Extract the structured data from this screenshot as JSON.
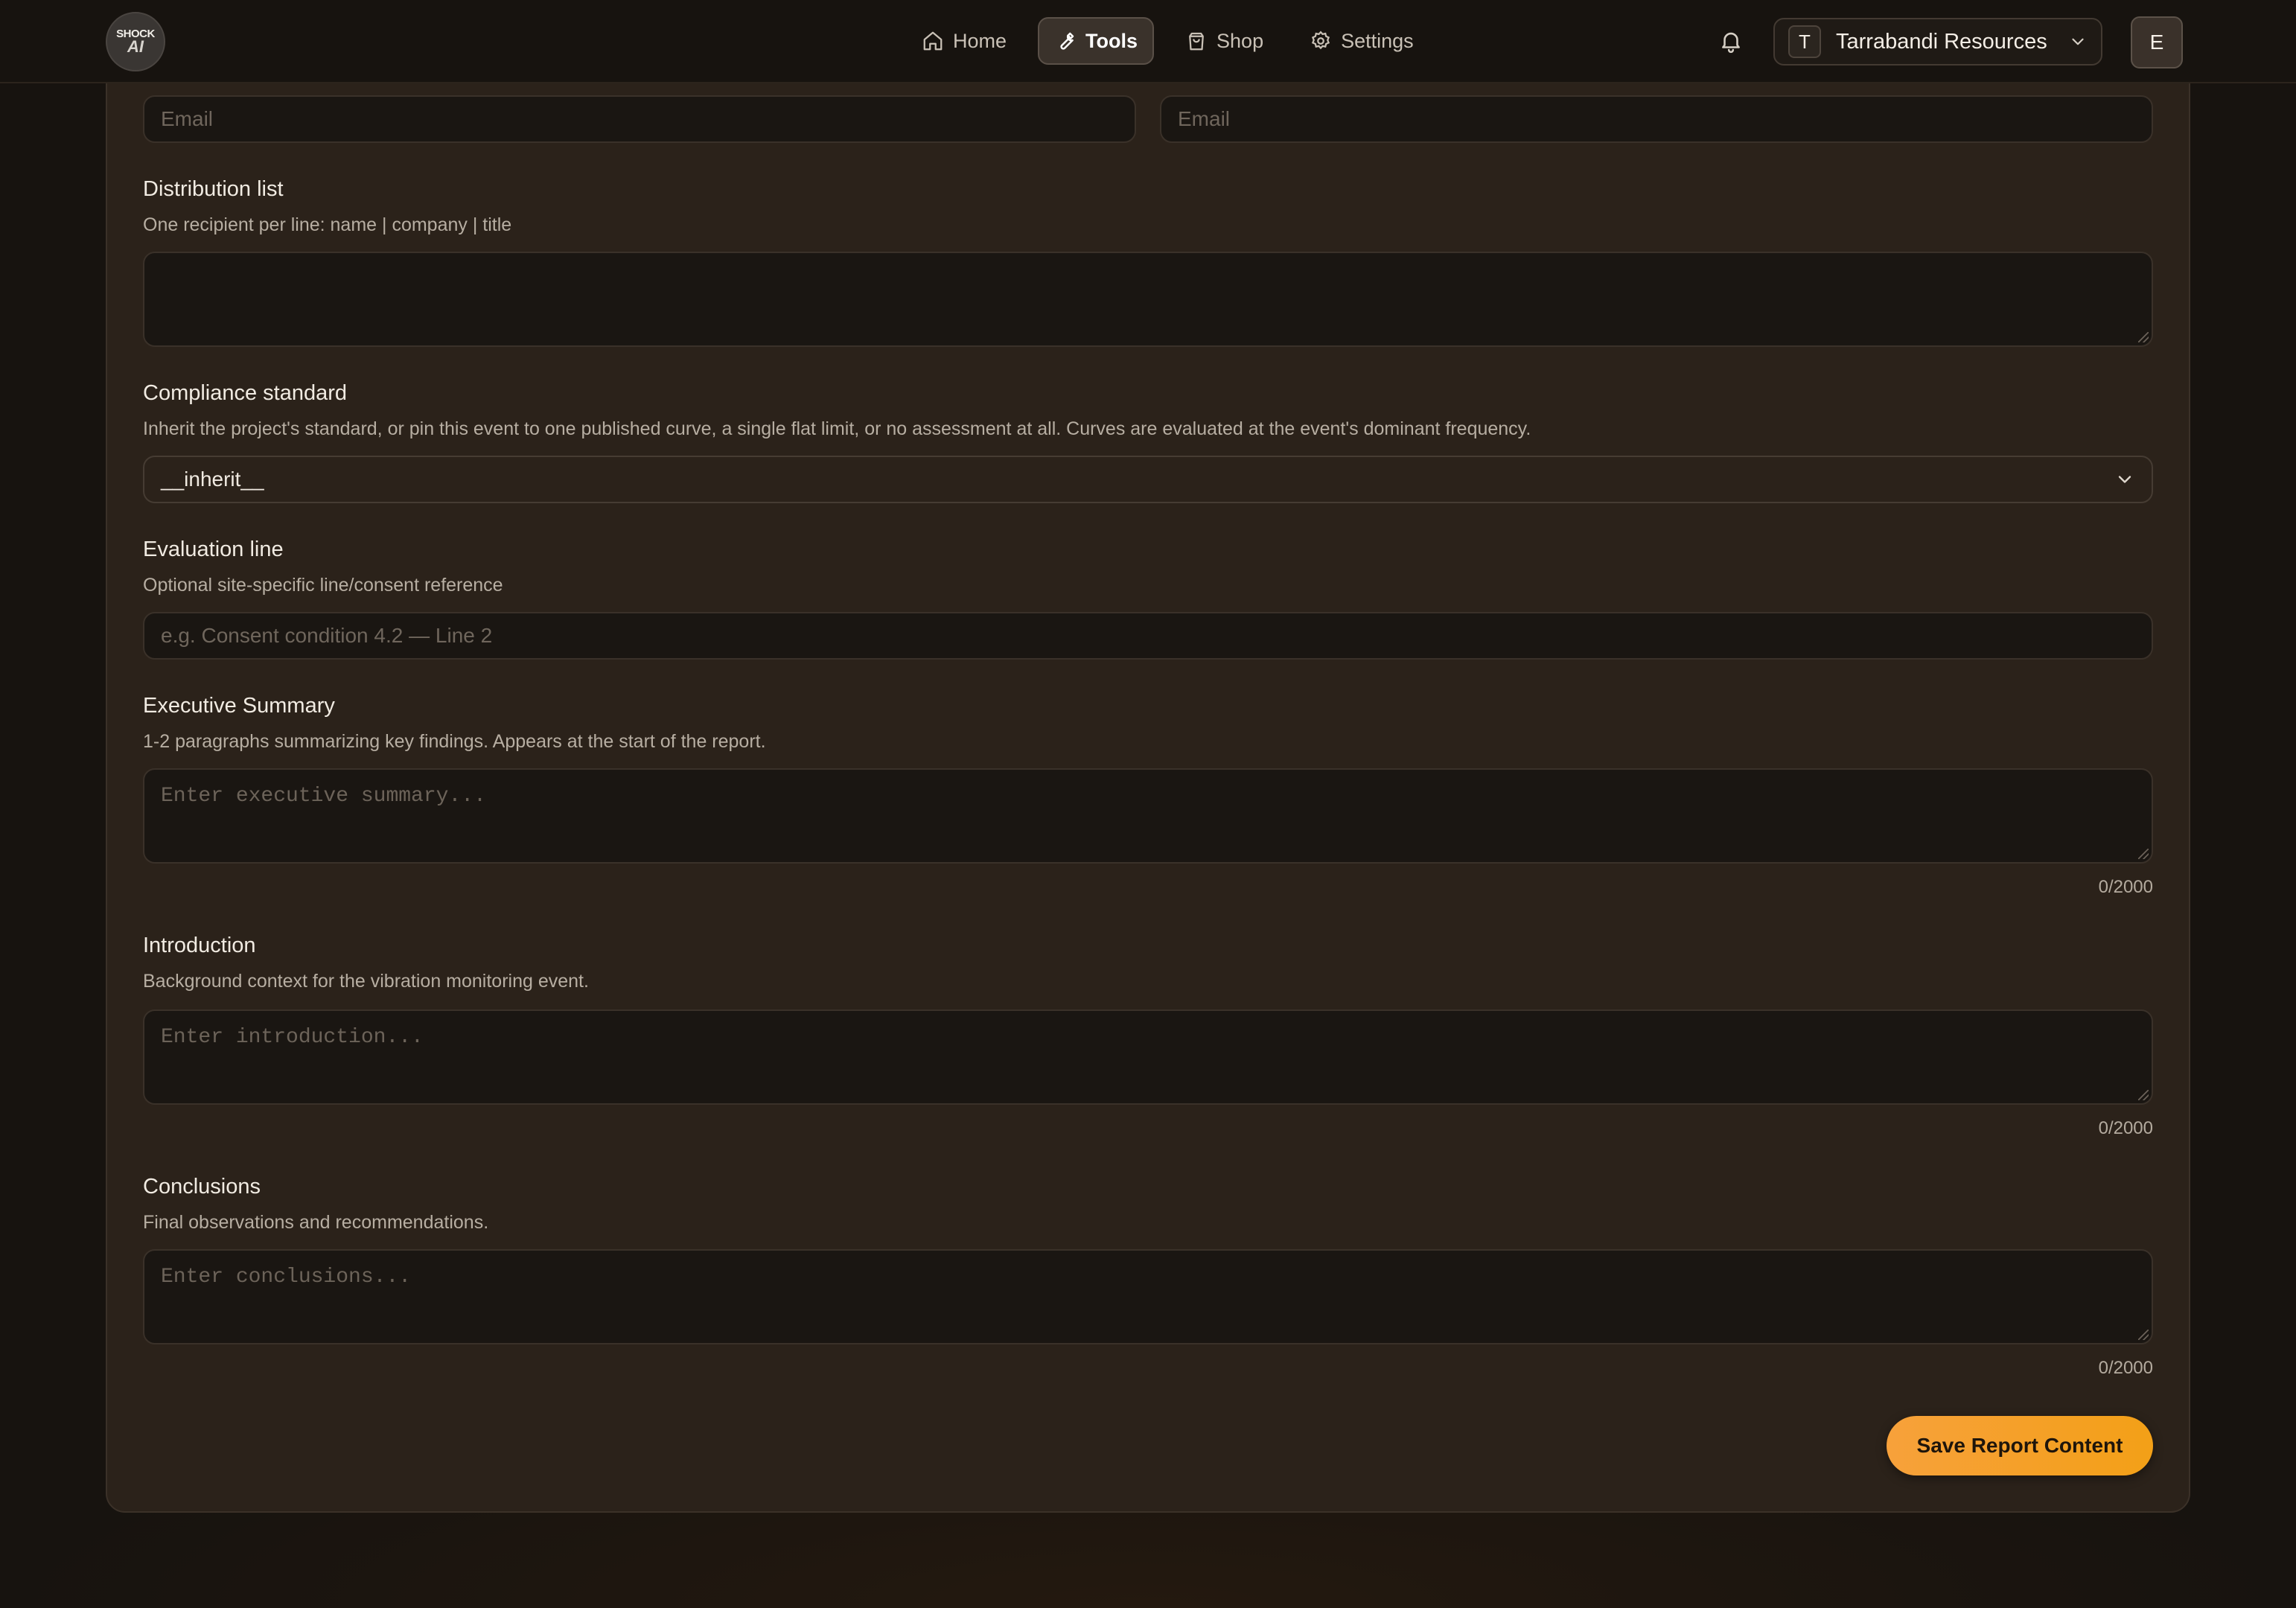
{
  "header": {
    "logo_text_top": "SHOCK",
    "logo_text_bottom": "AI",
    "nav": [
      {
        "label": "Home",
        "icon": "home-icon"
      },
      {
        "label": "Tools",
        "icon": "wrench-icon",
        "active": true
      },
      {
        "label": "Shop",
        "icon": "shopping-bag-icon"
      },
      {
        "label": "Settings",
        "icon": "gear-icon"
      }
    ],
    "org_initial": "T",
    "org_name": "Tarrabandi Resources",
    "avatar_initial": "E"
  },
  "form": {
    "email_left_placeholder": "Email",
    "email_right_placeholder": "Email",
    "distribution": {
      "label": "Distribution list",
      "help": "One recipient per line: name | company | title",
      "value": ""
    },
    "compliance": {
      "label": "Compliance standard",
      "help": "Inherit the project's standard, or pin this event to one published curve, a single flat limit, or no assessment at all. Curves are evaluated at the event's dominant frequency.",
      "selected": "__inherit__"
    },
    "evaluation": {
      "label": "Evaluation line",
      "help": "Optional site-specific line/consent reference",
      "placeholder": "e.g. Consent condition 4.2 — Line 2"
    },
    "executive": {
      "label": "Executive Summary",
      "help": "1-2 paragraphs summarizing key findings. Appears at the start of the report.",
      "placeholder": "Enter executive summary...",
      "counter": "0/2000"
    },
    "introduction": {
      "label": "Introduction",
      "help": "Background context for the vibration monitoring event.",
      "placeholder": "Enter introduction...",
      "counter": "0/2000"
    },
    "conclusions": {
      "label": "Conclusions",
      "help": "Final observations and recommendations.",
      "placeholder": "Enter conclusions...",
      "counter": "0/2000"
    },
    "save_label": "Save Report Content"
  },
  "colors": {
    "accent": "#f59e2a",
    "background": "#17130f",
    "card": "#2b221a"
  }
}
